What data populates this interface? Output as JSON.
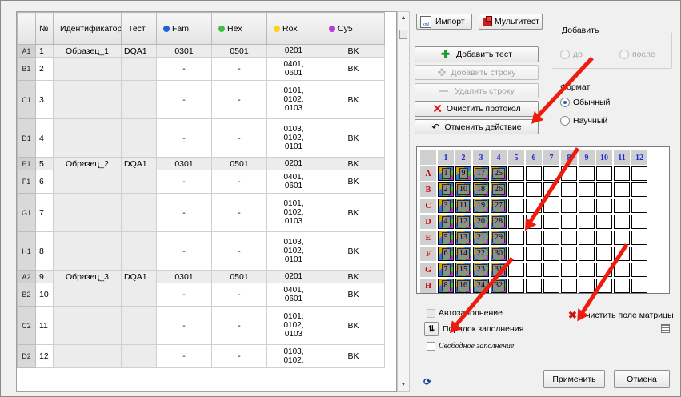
{
  "table": {
    "headers": {
      "num": "№",
      "id": "Идентификатор",
      "test": "Тест",
      "fam": "Fam",
      "hex": "Hex",
      "rox": "Rox",
      "cy5": "Cy5"
    },
    "dot_colors": {
      "fam": "#1f5fe0",
      "hex": "#3cc23c",
      "rox": "#ffd21a",
      "cy5": "#b43cd8"
    },
    "rows": [
      {
        "well": "A1",
        "num": "1",
        "id": "Образец_1",
        "test": "DQA1",
        "fam": "0301",
        "hex": "0501",
        "rox": "0201",
        "cy5": "BK",
        "first": true
      },
      {
        "well": "B1",
        "num": "2",
        "id": "",
        "test": "",
        "fam": "-",
        "hex": "-",
        "rox": "0401,\n0601",
        "cy5": "BK"
      },
      {
        "well": "C1",
        "num": "3",
        "id": "",
        "test": "",
        "fam": "-",
        "hex": "-",
        "rox": "0101,\n0102,\n0103",
        "cy5": "BK"
      },
      {
        "well": "D1",
        "num": "4",
        "id": "",
        "test": "",
        "fam": "-",
        "hex": "-",
        "rox": "0103,\n0102,\n0101",
        "cy5": "BK"
      },
      {
        "well": "E1",
        "num": "5",
        "id": "Образец_2",
        "test": "DQA1",
        "fam": "0301",
        "hex": "0501",
        "rox": "0201",
        "cy5": "BK",
        "first": true
      },
      {
        "well": "F1",
        "num": "6",
        "id": "",
        "test": "",
        "fam": "-",
        "hex": "-",
        "rox": "0401,\n0601",
        "cy5": "BK"
      },
      {
        "well": "G1",
        "num": "7",
        "id": "",
        "test": "",
        "fam": "-",
        "hex": "-",
        "rox": "0101,\n0102,\n0103",
        "cy5": "BK"
      },
      {
        "well": "H1",
        "num": "8",
        "id": "",
        "test": "",
        "fam": "-",
        "hex": "-",
        "rox": "0103,\n0102,\n0101",
        "cy5": "BK"
      },
      {
        "well": "A2",
        "num": "9",
        "id": "Образец_3",
        "test": "DQA1",
        "fam": "0301",
        "hex": "0501",
        "rox": "0201",
        "cy5": "BK",
        "first": true
      },
      {
        "well": "B2",
        "num": "10",
        "id": "",
        "test": "",
        "fam": "-",
        "hex": "-",
        "rox": "0401,\n0601",
        "cy5": "BK"
      },
      {
        "well": "C2",
        "num": "11",
        "id": "",
        "test": "",
        "fam": "-",
        "hex": "-",
        "rox": "0101,\n0102,\n0103",
        "cy5": "BK"
      },
      {
        "well": "D2",
        "num": "12",
        "id": "",
        "test": "",
        "fam": "-",
        "hex": "-",
        "rox": "0103,\n0102.",
        "cy5": "BK"
      }
    ]
  },
  "toolbar": {
    "import_label": "Импорт",
    "import_icon": "xml",
    "multitest_label": "Мультитест"
  },
  "actions": {
    "add_test": "Добавить тест",
    "add_row": "Добавить строку",
    "delete_row": "Удалить строку",
    "clear_protocol": "Очистить протокол",
    "undo": "Отменить действие"
  },
  "add_group": {
    "title": "Добавить",
    "option_before": "до",
    "option_after": "после"
  },
  "format_group": {
    "title": "Формат",
    "option_normal": "Обычный",
    "option_scientific": "Научный",
    "selected": "Обычный"
  },
  "matrix": {
    "columns": [
      "1",
      "2",
      "3",
      "4",
      "5",
      "6",
      "7",
      "8",
      "9",
      "10",
      "11",
      "12"
    ],
    "rows": [
      "A",
      "B",
      "C",
      "D",
      "E",
      "F",
      "G",
      "H"
    ],
    "filled": [
      [
        "1",
        "9",
        "17",
        "25"
      ],
      [
        "2",
        "10",
        "18",
        "26"
      ],
      [
        "3",
        "11",
        "19",
        "27"
      ],
      [
        "4",
        "12",
        "20",
        "28"
      ],
      [
        "5",
        "13",
        "21",
        "29"
      ],
      [
        "6",
        "14",
        "22",
        "30"
      ],
      [
        "7",
        "15",
        "23",
        "31"
      ],
      [
        "8",
        "16",
        "24",
        "32"
      ]
    ]
  },
  "fill": {
    "auto_fill_label": "Автозаполнение",
    "fill_order_label": "Порядок заполнения",
    "free_fill_label": "Свободное заполнение",
    "clear_matrix_label": "Очистить поле матрицы"
  },
  "footer": {
    "apply": "Применить",
    "cancel": "Отмена"
  },
  "annotation_color": "#ee1c0e"
}
